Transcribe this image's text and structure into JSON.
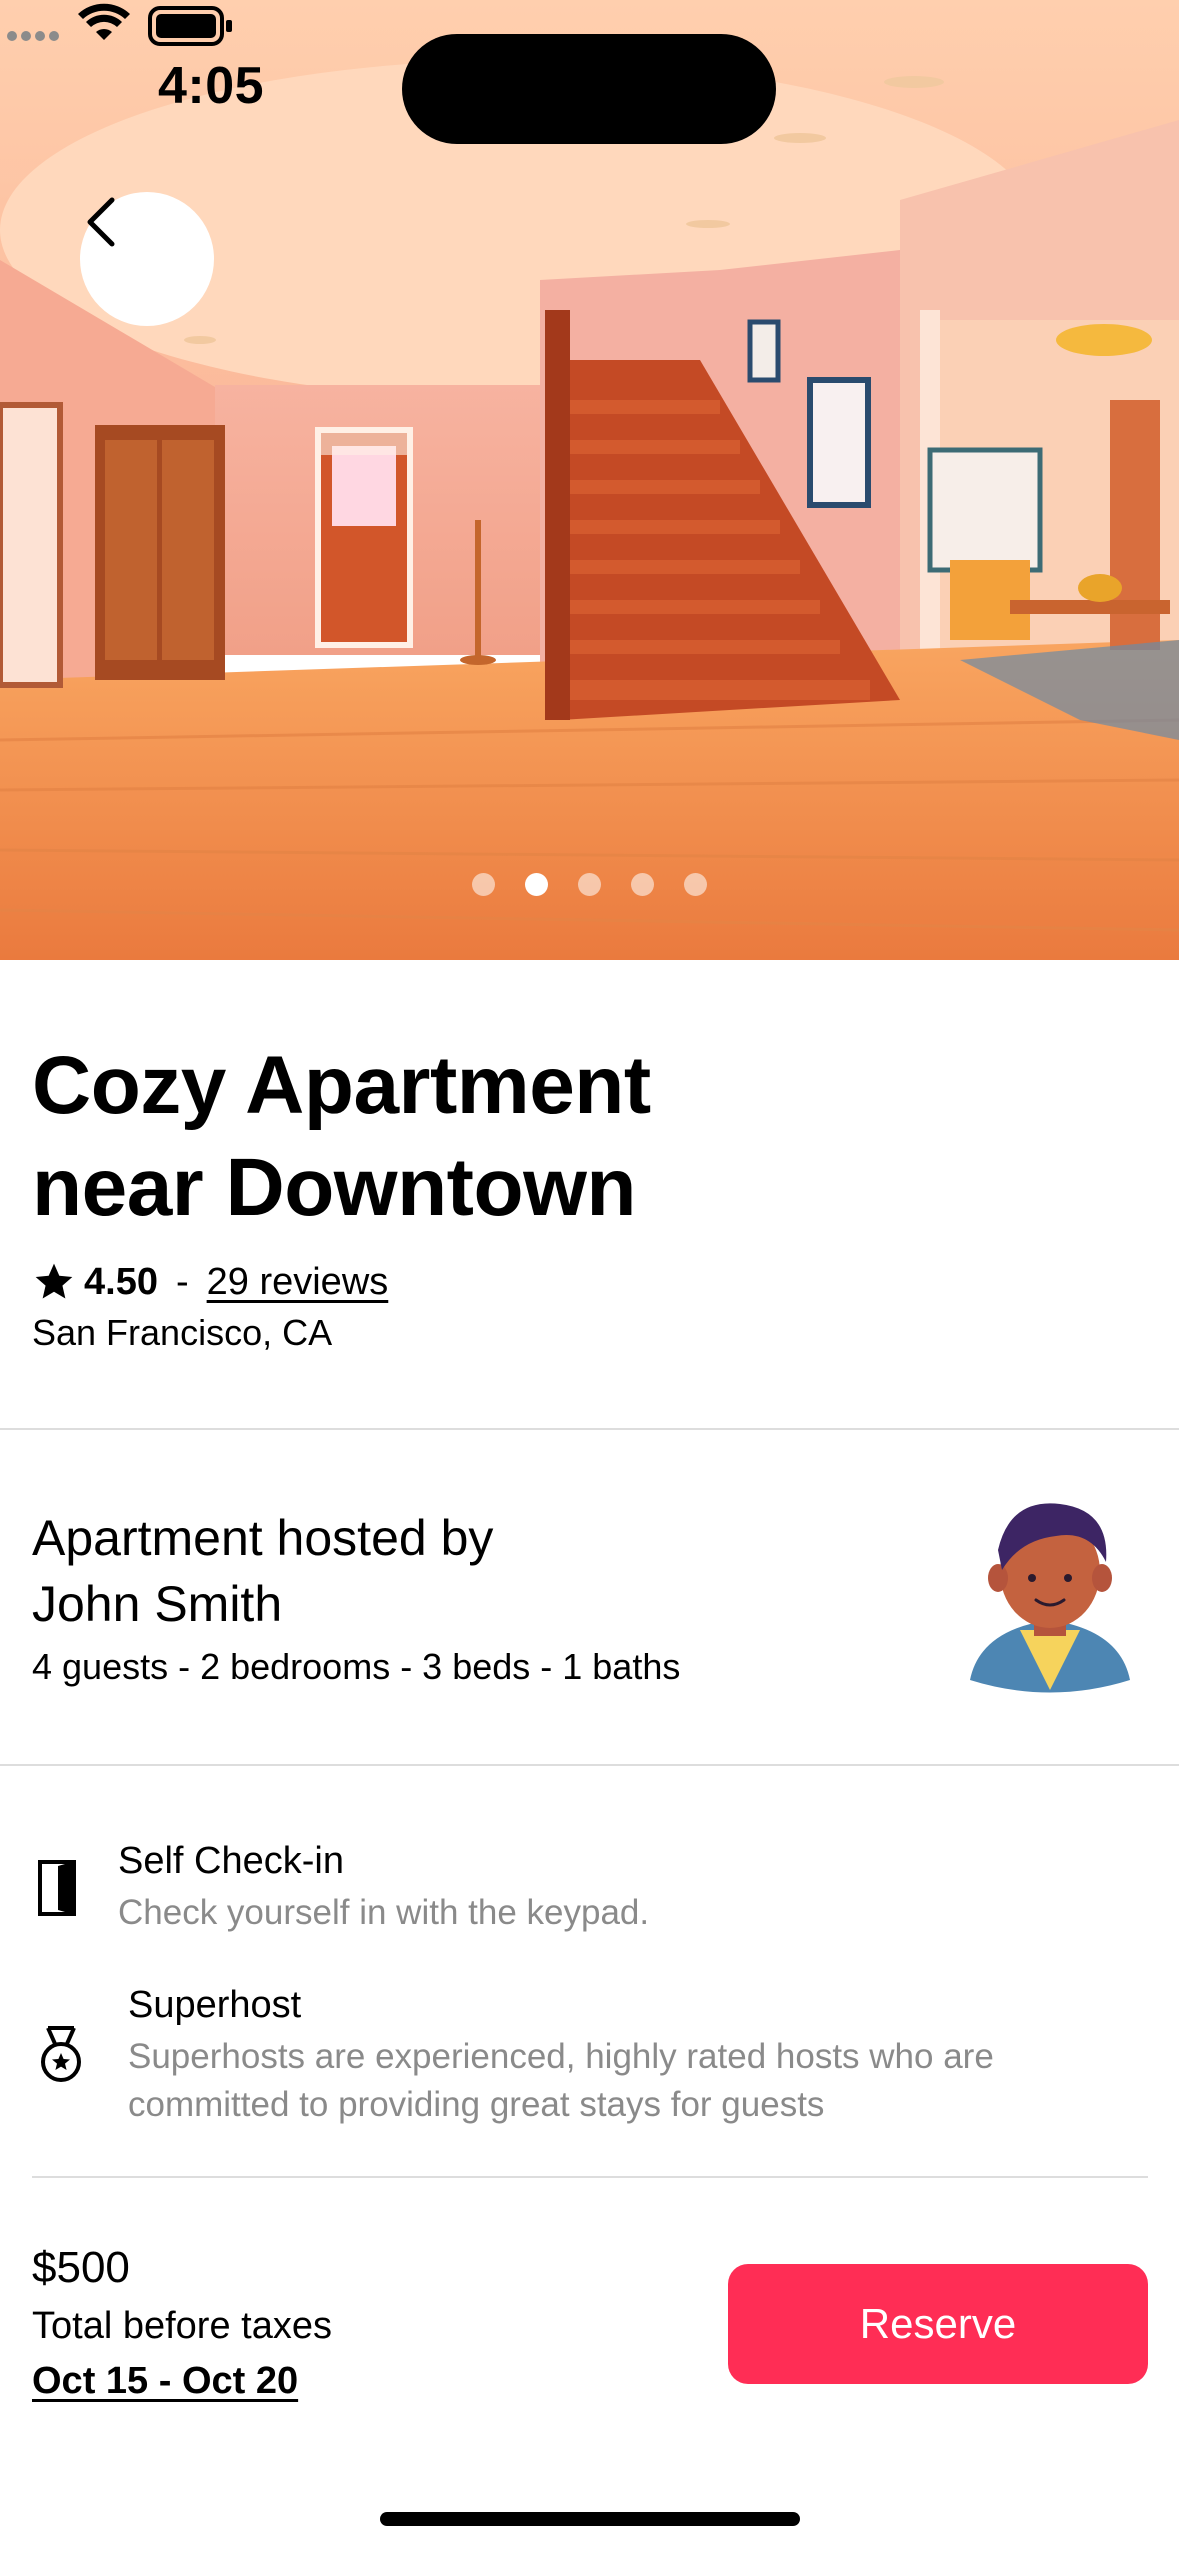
{
  "status_bar": {
    "time": "4:05"
  },
  "listing": {
    "title_line1": "Cozy Apartment",
    "title_line2": "near Downtown",
    "rating": "4.50",
    "separator": "-",
    "reviews": "29 reviews",
    "location": "San Francisco, CA",
    "photo_count": 5,
    "active_photo_index": 1
  },
  "host": {
    "title_line1": "Apartment hosted by",
    "title_line2": "John Smith",
    "specs": "4 guests - 2 bedrooms - 3 beds - 1 baths"
  },
  "features": [
    {
      "icon": "door-icon",
      "title": "Self Check-in",
      "desc_line1": "Check yourself in with the keypad."
    },
    {
      "icon": "medal-icon",
      "title": "Superhost",
      "desc_line1": "Superhosts are experienced, highly rated hosts who are",
      "desc_line2": "committed to providing great stays for guests"
    }
  ],
  "booking": {
    "price": "$500",
    "price_note": "Total before taxes",
    "dates": "Oct 15 - Oct 20",
    "reserve_label": "Reserve"
  },
  "colors": {
    "accent": "#ff2d55",
    "muted_text": "#8a8a8a",
    "divider": "#dddddd"
  }
}
